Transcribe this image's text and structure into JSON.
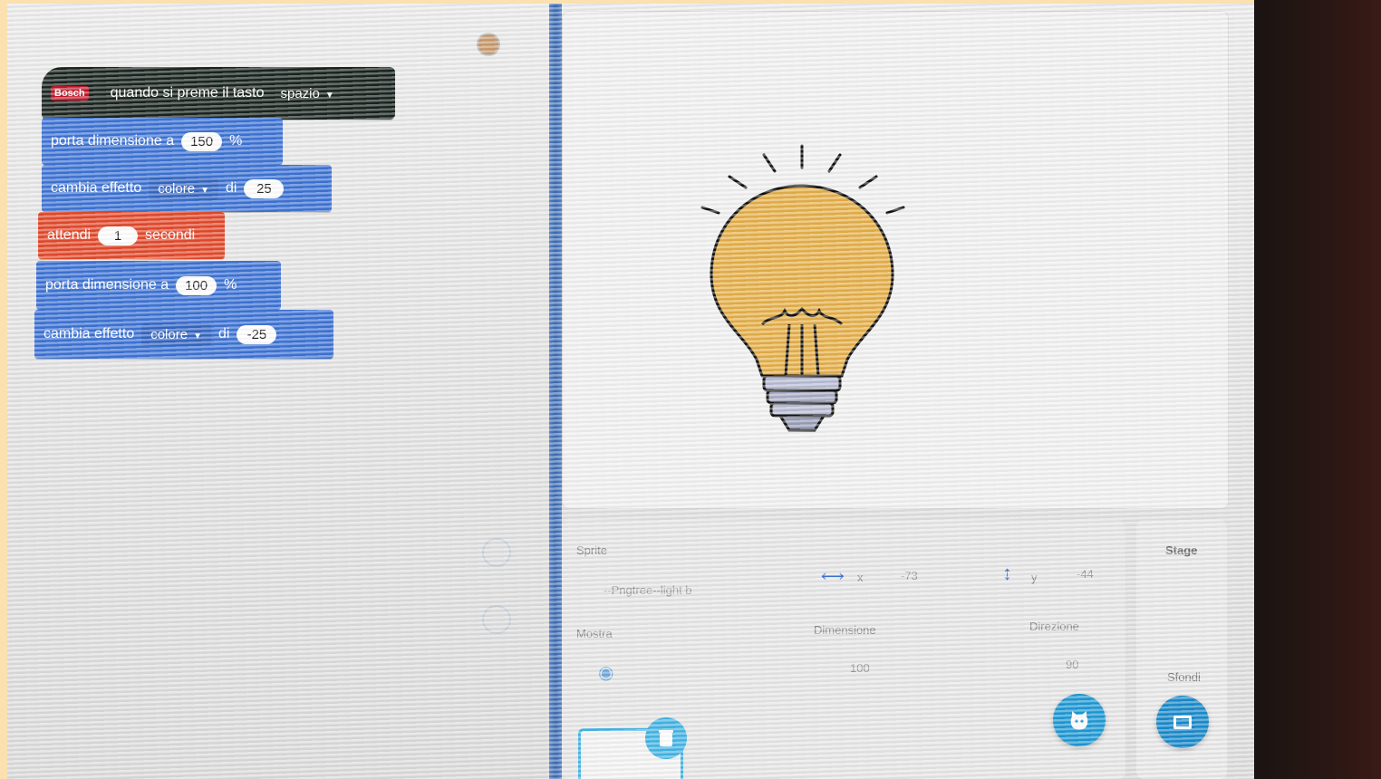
{
  "code": {
    "hat": {
      "badge": "Bosch",
      "text": "quando si preme il tasto",
      "key": "spazio"
    },
    "blocks": [
      {
        "text1": "porta dimensione a",
        "value": "150",
        "text2": "%"
      },
      {
        "text1": "cambia effetto",
        "dropdown": "colore",
        "text2": "di",
        "value": "25"
      },
      {
        "text1": "attendi",
        "value": "1",
        "text2": "secondi"
      },
      {
        "text1": "porta dimensione a",
        "value": "100",
        "text2": "%"
      },
      {
        "text1": "cambia effetto",
        "dropdown": "colore",
        "text2": "di",
        "value": "-25"
      }
    ]
  },
  "sprite_info": {
    "sprite_label": "Sprite",
    "sprite_name": "--Pngtree--light b",
    "x_label": "x",
    "x_value": "-73",
    "y_label": "y",
    "y_value": "-44",
    "show_label": "Mostra",
    "size_label": "Dimensione",
    "size_value": "100",
    "direction_label": "Direzione",
    "direction_value": "90"
  },
  "stage_panel": {
    "title": "Stage",
    "backdrops_label": "Sfondi"
  },
  "colors": {
    "events_block": "#1a241f",
    "looks_block": "#3e74d6",
    "control_block": "#e34a2c",
    "accent": "#1f9ad6"
  },
  "icons": [
    "eye-icon",
    "arrows-horizontal-icon",
    "arrows-vertical-icon",
    "choose-sprite-icon",
    "choose-backdrop-icon",
    "trash-icon",
    "lightbulb-sprite"
  ]
}
